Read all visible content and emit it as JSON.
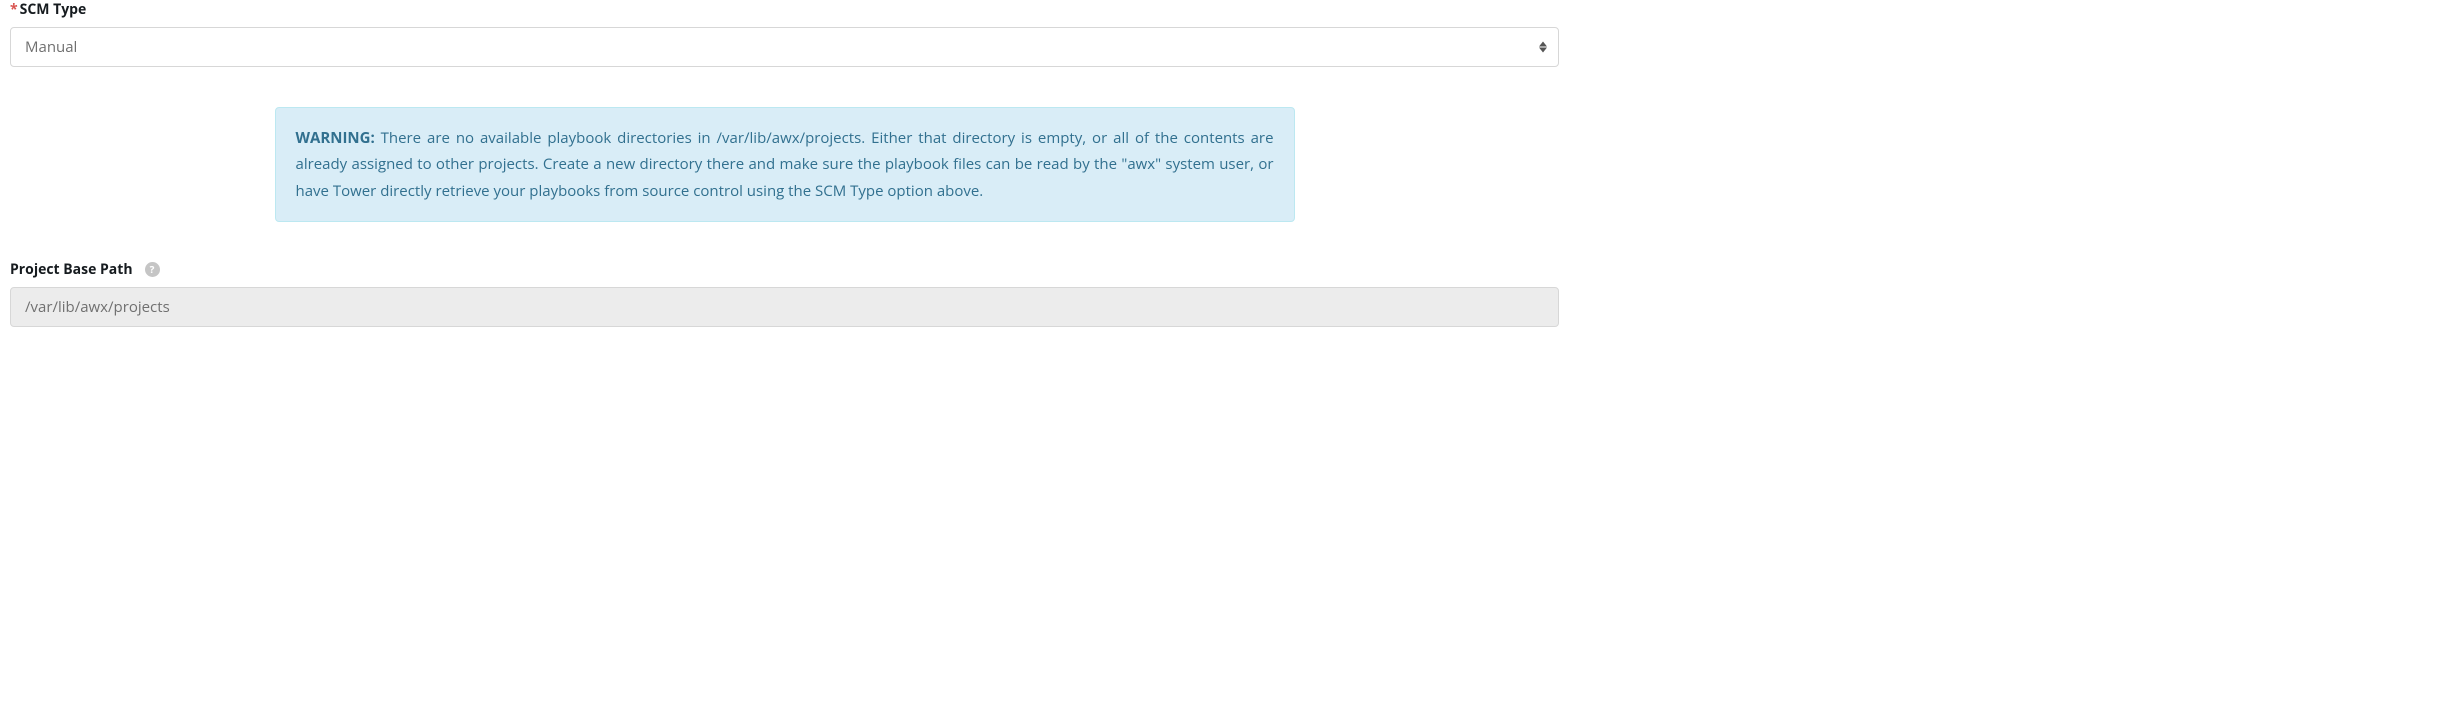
{
  "scm_type": {
    "label": "SCM Type",
    "required_marker": "*",
    "value": "Manual"
  },
  "warning": {
    "prefix": "WARNING:",
    "message": " There are no available playbook directories in /var/lib/awx/projects. Either that directory is empty, or all of the contents are already assigned to other projects. Create a new directory there and make sure the playbook files can be read by the \"awx\" system user, or have Tower directly retrieve your playbooks from source control using the SCM Type option above."
  },
  "project_base_path": {
    "label": "Project Base Path",
    "help_text": "?",
    "value": "/var/lib/awx/projects"
  }
}
